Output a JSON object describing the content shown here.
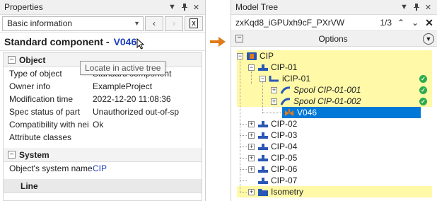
{
  "properties": {
    "title": "Properties",
    "selector": "Basic information",
    "header_type": "Standard component -",
    "header_link": "V046",
    "tooltip": "Locate in active tree",
    "sections": [
      {
        "name": "Object",
        "rows": [
          {
            "key": "Type of object",
            "value": "Standard component"
          },
          {
            "key": "Owner info",
            "value": "ExampleProject"
          },
          {
            "key": "Modification time",
            "value": "2022-12-20 11:08:36"
          },
          {
            "key": "Spec status of part",
            "value": "Unauthorized out-of-sp"
          },
          {
            "key": "Compatibility with nei",
            "value": "Ok"
          },
          {
            "key": "Attribute classes",
            "value": ""
          }
        ]
      },
      {
        "name": "System",
        "rows": [
          {
            "key": "Object's system name",
            "value": "CIP"
          }
        ]
      },
      {
        "name": "Line",
        "rows": []
      }
    ]
  },
  "tree": {
    "title": "Model Tree",
    "search_value": "zxKqd8_iGPUxh9cF_PXrVW",
    "match_count": "1/3",
    "options_label": "Options",
    "nodes": {
      "root": "CIP",
      "cip01": "CIP-01",
      "icip01": "iCIP-01",
      "spool1": "Spool CIP-01-001",
      "spool2": "Spool CIP-01-002",
      "v046": "V046",
      "cip02": "CIP-02",
      "cip03": "CIP-03",
      "cip04": "CIP-04",
      "cip05": "CIP-05",
      "cip06": "CIP-06",
      "cip07": "CIP-07",
      "iso": "Isometry"
    }
  },
  "colors": {
    "accent_arrow": "#e07b1a",
    "link": "#1f3fbf",
    "highlight": "#fff9a8",
    "selection": "#0078d7",
    "ok": "#2eab4b"
  }
}
